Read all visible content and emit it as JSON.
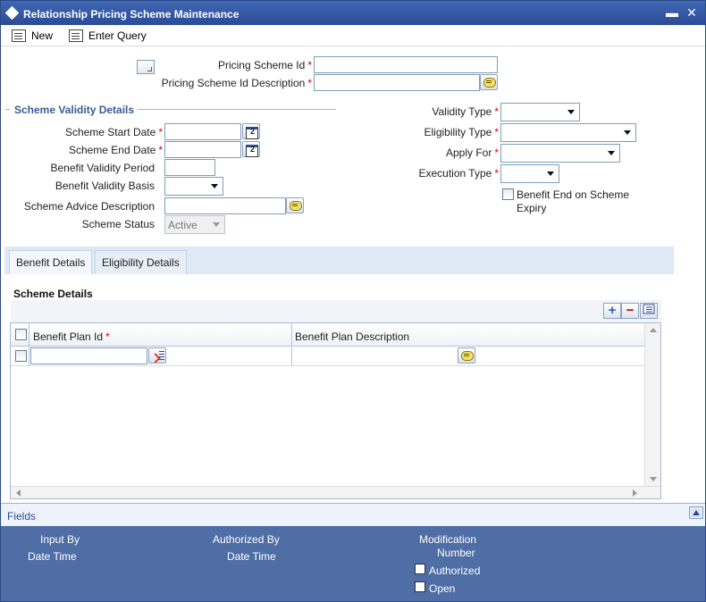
{
  "window": {
    "title": "Relationship Pricing Scheme Maintenance",
    "minimize": "▬",
    "close": "✕"
  },
  "toolbar": {
    "new_label": "New",
    "enter_query_label": "Enter Query"
  },
  "header": {
    "scheme_id_label": "Pricing Scheme Id",
    "scheme_id_value": "",
    "scheme_desc_label": "Pricing Scheme Id Description",
    "scheme_desc_value": ""
  },
  "validity": {
    "section_title": "Scheme Validity Details",
    "start_date_label": "Scheme Start Date",
    "start_date_value": "",
    "end_date_label": "Scheme End Date",
    "end_date_value": "",
    "benefit_period_label": "Benefit Validity Period",
    "benefit_period_value": "",
    "benefit_basis_label": "Benefit Validity Basis",
    "benefit_basis_value": "",
    "advice_desc_label": "Scheme Advice Description",
    "advice_desc_value": "",
    "status_label": "Scheme Status",
    "status_value": "Active"
  },
  "right": {
    "validity_type_label": "Validity Type",
    "validity_type_value": "",
    "eligibility_type_label": "Eligibility Type",
    "eligibility_type_value": "",
    "apply_for_label": "Apply For",
    "apply_for_value": "",
    "execution_type_label": "Execution Type",
    "execution_type_value": "",
    "benefit_end_label_1": "Benefit End on Scheme",
    "benefit_end_label_2": "Expiry",
    "benefit_end_checked": false
  },
  "required_mark": "*",
  "tabs": [
    {
      "label": "Benefit Details",
      "active": true
    },
    {
      "label": "Eligibility Details",
      "active": false
    }
  ],
  "grid": {
    "title": "Scheme Details",
    "add": "+",
    "remove": "−",
    "columns": [
      "Benefit Plan Id",
      "Benefit Plan Description"
    ],
    "rows": [
      {
        "benefit_plan_id": "",
        "benefit_plan_description": ""
      }
    ]
  },
  "footer": {
    "fields_label": "Fields",
    "input_by": "Input By",
    "input_datetime": "Date Time",
    "authorized_by": "Authorized By",
    "auth_datetime": "Date Time",
    "modification_1": "Modification",
    "modification_2": "Number",
    "authorized": "Authorized",
    "open": "Open"
  }
}
